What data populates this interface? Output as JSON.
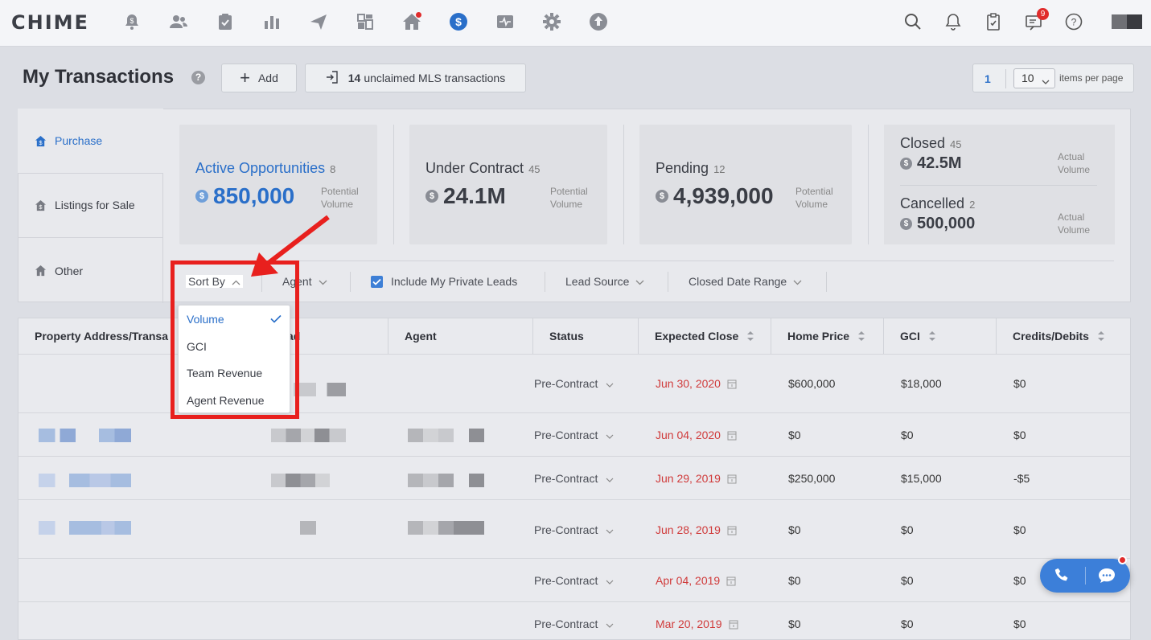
{
  "app": {
    "logo": "CHIME"
  },
  "nav": {
    "icons": [
      "bell-dollar-icon",
      "people-icon",
      "clipboard-icon",
      "bar-chart-icon",
      "send-icon",
      "dashboard-grid-icon",
      "home-icon",
      "dollar-icon",
      "activity-icon",
      "gear-icon",
      "upload-icon"
    ],
    "right_icons": [
      "search-icon",
      "notification-bell-icon",
      "task-icon",
      "messages-icon",
      "help-icon"
    ],
    "messages_badge": "9"
  },
  "header": {
    "title": "My Transactions",
    "help": "?",
    "add_label": "Add",
    "mls_count": "14",
    "mls_label": "unclaimed MLS transactions",
    "page_number": "1",
    "per_page": "10",
    "per_page_label": "items per page"
  },
  "side_tabs": [
    {
      "label": "Purchase"
    },
    {
      "label": "Listings for Sale"
    },
    {
      "label": "Other"
    }
  ],
  "cards": [
    {
      "title": "Active Opportunities",
      "count": "8",
      "value": "850,000",
      "sub1": "Potential",
      "sub2": "Volume"
    },
    {
      "title": "Under Contract",
      "count": "45",
      "value": "24.1M",
      "sub1": "Potential",
      "sub2": "Volume"
    },
    {
      "title": "Pending",
      "count": "12",
      "value": "4,939,000",
      "sub1": "Potential",
      "sub2": "Volume"
    }
  ],
  "closed_card": {
    "closed_title": "Closed",
    "closed_count": "45",
    "closed_value": "42.5M",
    "cancelled_title": "Cancelled",
    "cancelled_count": "2",
    "cancelled_value": "500,000",
    "sub1": "Actual",
    "sub2": "Volume"
  },
  "filters": {
    "sort_by": "Sort By",
    "agent": "Agent",
    "include_private": "Include My Private Leads",
    "lead_source": "Lead Source",
    "closed_date_range": "Closed Date Range"
  },
  "sort_options": [
    {
      "label": "Volume",
      "selected": true
    },
    {
      "label": "GCI"
    },
    {
      "label": "Team Revenue"
    },
    {
      "label": "Agent Revenue"
    }
  ],
  "table": {
    "columns": [
      "Property Address/Transa",
      "ad",
      "Agent",
      "Status",
      "Expected Close",
      "Home Price",
      "GCI",
      "Credits/Debits"
    ],
    "rows": [
      {
        "status": "Pre-Contract",
        "close": "Jun 30, 2020",
        "price": "$600,000",
        "gci": "$18,000",
        "credits": "$0"
      },
      {
        "status": "Pre-Contract",
        "close": "Jun 04, 2020",
        "price": "$0",
        "gci": "$0",
        "credits": "$0"
      },
      {
        "status": "Pre-Contract",
        "close": "Jun 29, 2019",
        "price": "$250,000",
        "gci": "$15,000",
        "credits": "-$5"
      },
      {
        "status": "Pre-Contract",
        "close": "Jun 28, 2019",
        "price": "$0",
        "gci": "$0",
        "credits": "$0"
      },
      {
        "status": "Pre-Contract",
        "close": "Apr 04, 2019",
        "price": "$0",
        "gci": "$0",
        "credits": "$0"
      },
      {
        "status": "Pre-Contract",
        "close": "Mar 20, 2019",
        "price": "$0",
        "gci": "$0",
        "credits": "$0"
      }
    ]
  },
  "colors": {
    "accent": "#2a6fc9",
    "date_red": "#d03a3a",
    "highlight": "#e8201e"
  }
}
